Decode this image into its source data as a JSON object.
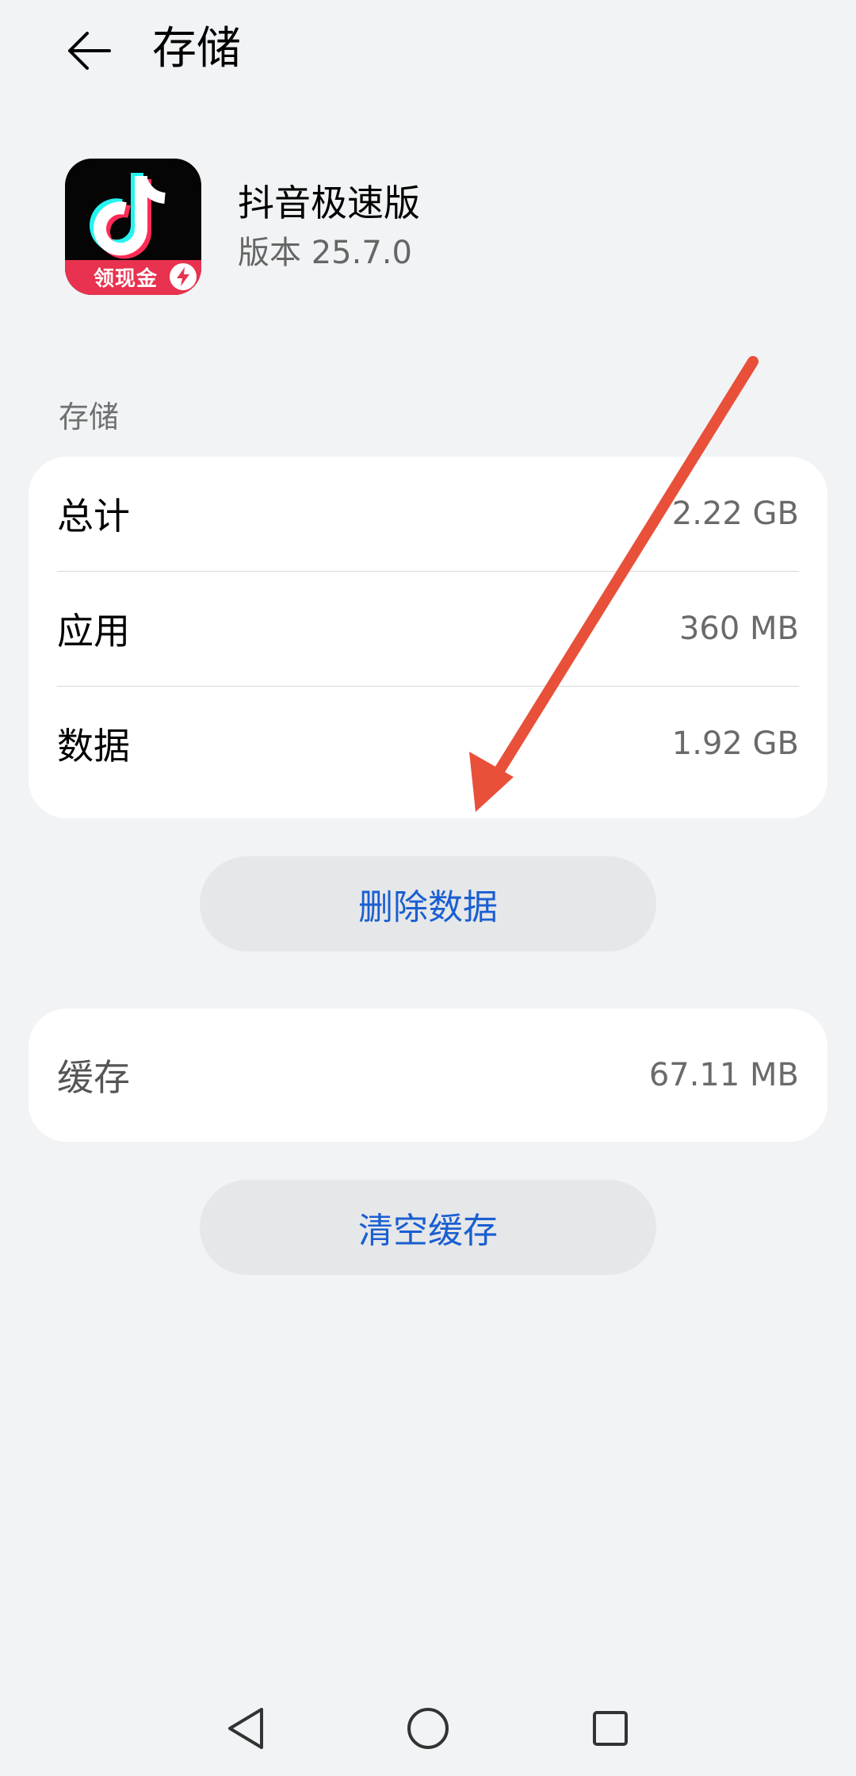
{
  "header": {
    "back_icon": "arrow-left-icon",
    "title": "存储"
  },
  "app": {
    "name": "抖音极速版",
    "version": "版本 25.7.0",
    "icon_badge": "领现金",
    "icon": "douyin-lite-app-icon"
  },
  "storage": {
    "section_label": "存储",
    "rows": [
      {
        "label": "总计",
        "value": "2.22 GB"
      },
      {
        "label": "应用",
        "value": "360 MB"
      },
      {
        "label": "数据",
        "value": "1.92 GB"
      }
    ],
    "delete_button": "删除数据"
  },
  "cache": {
    "label": "缓存",
    "value": "67.11 MB",
    "clear_button": "清空缓存"
  },
  "nav": {
    "back_icon": "triangle-back-icon",
    "home_icon": "circle-home-icon",
    "recent_icon": "square-recent-icon"
  },
  "colors": {
    "background": "#f1f3f5",
    "card": "#ffffff",
    "accent": "#1a5fd1",
    "annotation_arrow": "#e8503a",
    "icon_ribbon": "#e8324f"
  }
}
